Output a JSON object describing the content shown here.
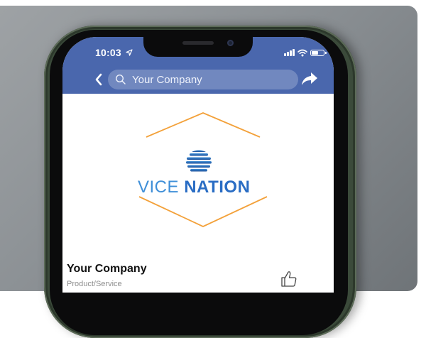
{
  "status_bar": {
    "time": "10:03"
  },
  "nav": {
    "search_text": "Your Company"
  },
  "page": {
    "logo_word_1": "VICE",
    "logo_word_2": "NATION",
    "name": "Your Company",
    "category": "Product/Service"
  },
  "icons": [
    "location-arrow-icon",
    "signal-icon",
    "wifi-icon",
    "battery-icon",
    "back-icon",
    "search-icon",
    "share-icon",
    "globe-icon",
    "like-icon"
  ],
  "colors": {
    "facebook_blue": "#4a67ad",
    "logo_orange": "#f3a13a",
    "logo_blue": "#2a6dc4",
    "frame_green": "#3b4a3a"
  },
  "battery_level": 0.6
}
